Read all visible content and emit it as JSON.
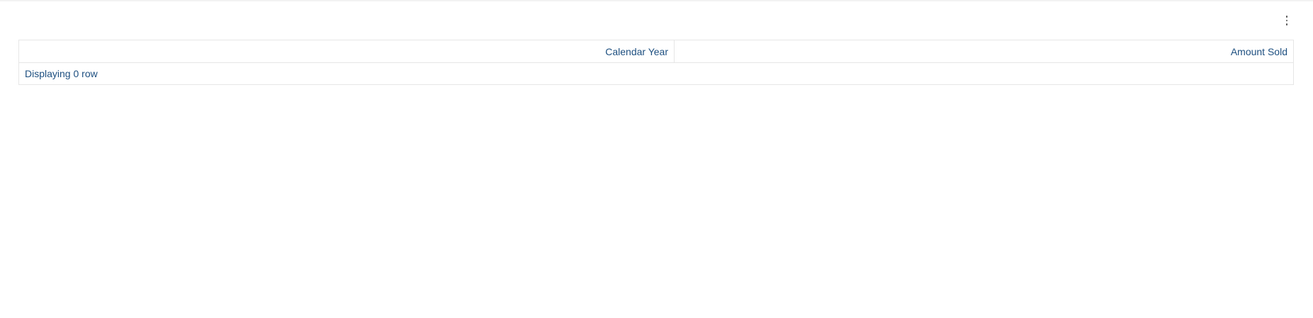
{
  "menu": {
    "icon": "more-vertical-icon"
  },
  "table": {
    "columns": [
      "Calendar Year",
      "Amount Sold"
    ],
    "rows": [],
    "footer": "Displaying 0 row"
  },
  "colors": {
    "text": "#1d4f80",
    "border": "#e6e6e6"
  }
}
